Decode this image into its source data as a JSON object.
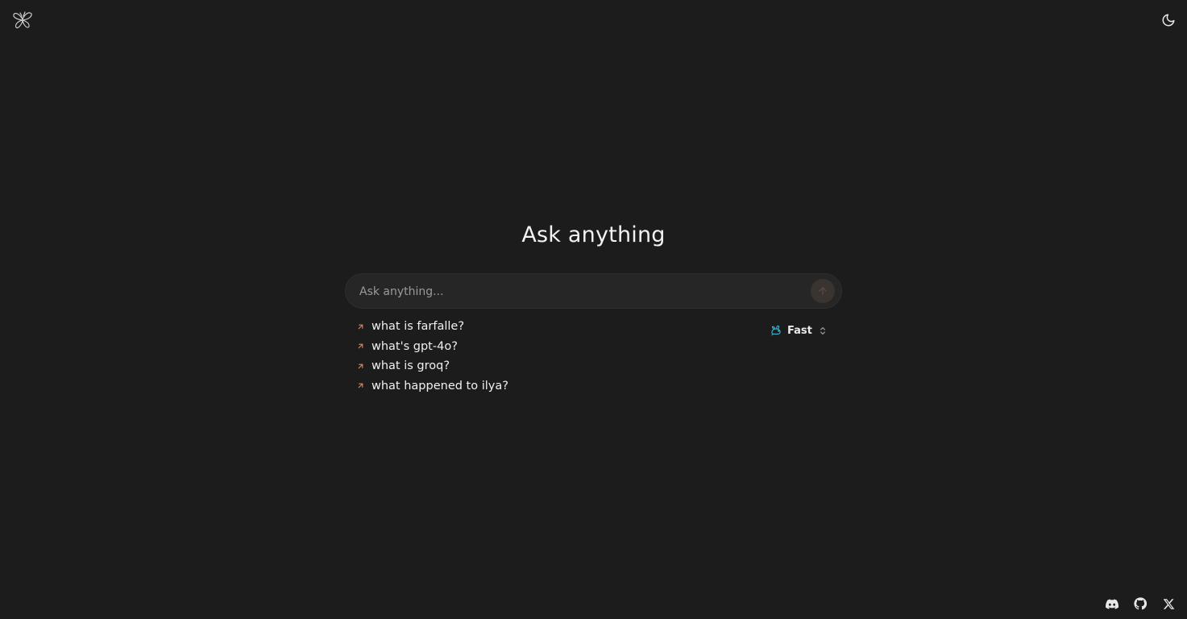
{
  "app": {
    "logo_icon": "farfalle-butterfly-logo",
    "theme_icon": "moon-icon"
  },
  "main": {
    "heading": "Ask anything",
    "search": {
      "placeholder": "Ask anything...",
      "value": ""
    },
    "send_icon": "arrow-up-icon",
    "suggestions": [
      {
        "label": "what is farfalle?",
        "icon": "arrow-up-right-icon"
      },
      {
        "label": "what's gpt-4o?",
        "icon": "arrow-up-right-icon"
      },
      {
        "label": "what is groq?",
        "icon": "arrow-up-right-icon"
      },
      {
        "label": "what happened to ilya?",
        "icon": "arrow-up-right-icon"
      }
    ],
    "model": {
      "label": "Fast",
      "icon": "rabbit-icon",
      "chevron_icon": "chevron-up-down-icon"
    }
  },
  "footer": {
    "icons": [
      "discord-icon",
      "github-icon",
      "x-icon"
    ]
  },
  "colors": {
    "background": "#1c1c1c",
    "accent_orange": "#e0895a",
    "model_icon_cyan": "#3cb4d2"
  }
}
